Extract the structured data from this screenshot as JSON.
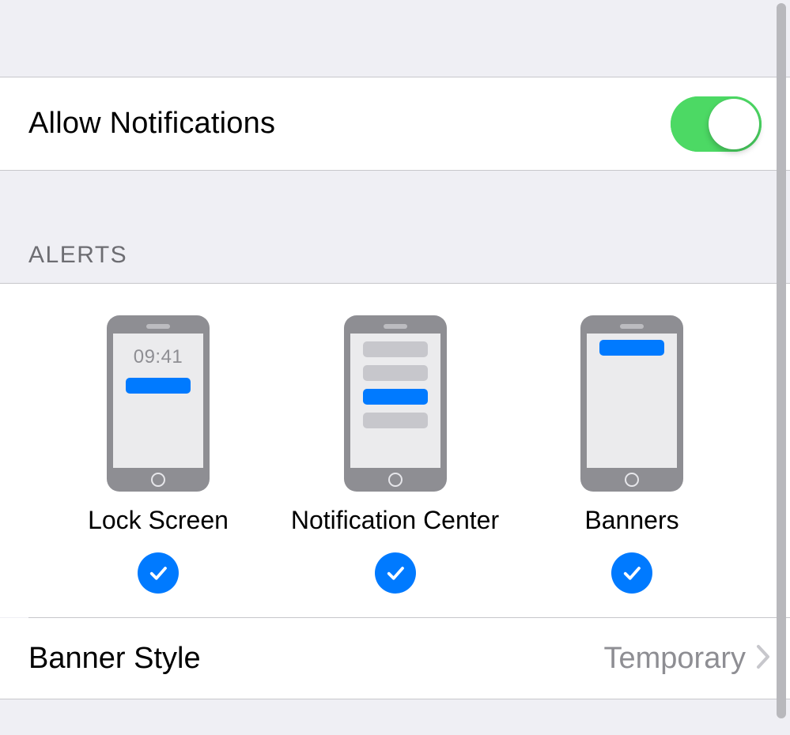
{
  "colors": {
    "accent_blue": "#007aff",
    "toggle_green": "#4cd964",
    "secondary_text": "#8e8e93"
  },
  "allow": {
    "label": "Allow Notifications",
    "enabled": true
  },
  "alerts": {
    "section_title": "ALERTS",
    "lock_screen": {
      "label": "Lock Screen",
      "checked": true,
      "clock": "09:41"
    },
    "notification_center": {
      "label": "Notification Center",
      "checked": true
    },
    "banners": {
      "label": "Banners",
      "checked": true
    }
  },
  "banner_style": {
    "label": "Banner Style",
    "value": "Temporary"
  }
}
